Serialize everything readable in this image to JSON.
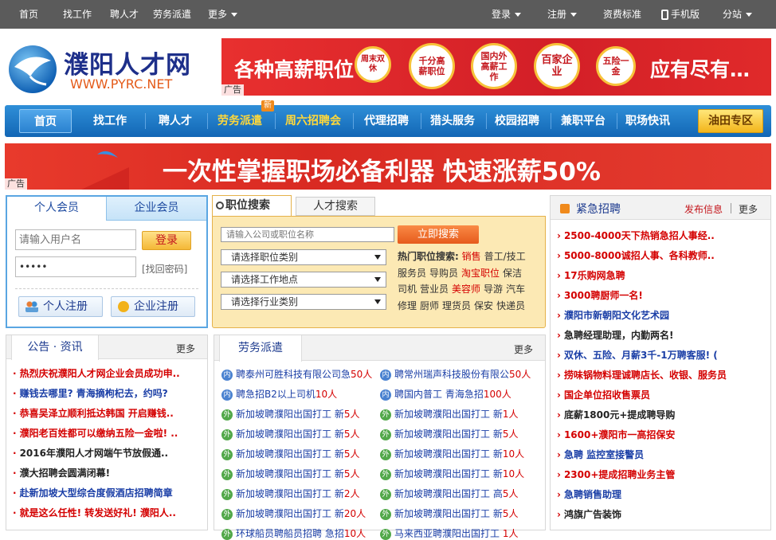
{
  "topbar": {
    "left": [
      "首页",
      "找工作",
      "聘人才",
      "劳务派遣",
      "更多"
    ],
    "login": "登录",
    "register": "注册",
    "fee": "资费标准",
    "mobile": "手机版",
    "branch": "分站"
  },
  "logo": {
    "name": "濮阳人才网",
    "url": "WWW.PYRC.NET"
  },
  "banner_top": {
    "headline": "各种高薪职位",
    "badges": [
      "周末双休",
      "千分高薪职位",
      "国内外高薪工作",
      "百家企业",
      "五险一金"
    ],
    "tail": "应有尽有…",
    "ad": "广告"
  },
  "nav": {
    "items": [
      "首页",
      "找工作",
      "聘人才",
      "劳务派遣",
      "周六招聘会",
      "代理招聘",
      "猎头服务",
      "校园招聘",
      "兼职平台",
      "职场快讯"
    ],
    "new_badge": "新",
    "special": "油田专区"
  },
  "banner_mid": {
    "headline": "一次性掌握职场必备利器 快速涨薪50%",
    "ad": "广告"
  },
  "login_panel": {
    "tab_personal": "个人会员",
    "tab_company": "企业会员",
    "username_placeholder": "请输入用户名",
    "password_value": "•••••",
    "login_button": "登录",
    "forgot": "[找回密码]",
    "personal_register": "个人注册",
    "company_register": "企业注册"
  },
  "search": {
    "tab_jobs": "职位搜索",
    "tab_talent": "人才搜索",
    "placeholder": "请输入公司或职位名称",
    "button": "立即搜索",
    "select_category": "请选择职位类别",
    "select_location": "请选择工作地点",
    "select_industry": "请选择行业类别",
    "hot_label": "热门职位搜索:",
    "hot_lines": [
      [
        {
          "t": "销售",
          "red": true
        },
        {
          "t": "普工/技工",
          "red": false
        }
      ],
      [
        {
          "t": "服务员",
          "red": false
        },
        {
          "t": "导购员",
          "red": false
        },
        {
          "t": "淘宝职位",
          "red": true
        },
        {
          "t": "保洁",
          "red": false
        }
      ],
      [
        {
          "t": "司机",
          "red": false
        },
        {
          "t": "营业员",
          "red": false
        },
        {
          "t": "美容师",
          "red": true
        },
        {
          "t": "导游",
          "red": false
        },
        {
          "t": "汽车",
          "red": false
        }
      ],
      [
        {
          "t": "修理",
          "red": false
        },
        {
          "t": "厨师",
          "red": false
        },
        {
          "t": "理货员",
          "red": false
        },
        {
          "t": "保安",
          "red": false
        },
        {
          "t": "快递员",
          "red": false
        }
      ]
    ]
  },
  "urgent": {
    "title": "紧急招聘",
    "publish": "发布信息",
    "more": "更多",
    "items": [
      {
        "t": "2500-4000天下热销急招人事经..",
        "c": "red"
      },
      {
        "t": "5000-8000诚招人事、各科教师..",
        "c": "red"
      },
      {
        "t": "17乐购网急聘",
        "c": "red"
      },
      {
        "t": "3000聘厨师一名!",
        "c": "red"
      },
      {
        "t": "濮阳市新朝阳文化艺术园",
        "c": "blue"
      },
      {
        "t": "急聘经理助理，内勤两名!",
        "c": "black"
      },
      {
        "t": "双休、五险、月薪3千-1万聘客服! (",
        "c": "blue"
      },
      {
        "t": "捞味锅物料理诚聘店长、收银、服务员",
        "c": "red"
      },
      {
        "t": "国企单位招收售票员",
        "c": "red"
      },
      {
        "t": "底薪1800元+提成聘导购",
        "c": "black"
      },
      {
        "t": "1600+濮阳市一高招保安",
        "c": "red"
      },
      {
        "t": "急聘 监控室接警员",
        "c": "blue"
      },
      {
        "t": "2300+提成招聘业务主管",
        "c": "red"
      },
      {
        "t": "急聘销售助理",
        "c": "blue"
      },
      {
        "t": "鸿旗广告装饰",
        "c": "black"
      }
    ]
  },
  "news": {
    "title": "公告 · 资讯",
    "more": "更多",
    "items": [
      {
        "t": "热烈庆祝濮阳人才网企业会员成功申..",
        "c": "red"
      },
      {
        "t": "赚钱去哪里? 青海摘枸杞去，约吗?",
        "c": "blue"
      },
      {
        "t": "恭喜吴泽立顺利抵达韩国 开启赚钱..",
        "c": "red"
      },
      {
        "t": "濮阳老百姓都可以缴纳五险一金啦! ..",
        "c": "red"
      },
      {
        "t": "2016年濮阳人才网端午节放假通..",
        "c": "black"
      },
      {
        "t": "濮大招聘会圆满闭幕!",
        "c": "black"
      },
      {
        "t": "赴新加坡大型综合度假酒店招聘简章",
        "c": "blue"
      },
      {
        "t": "就是这么任性! 转发送好礼! 濮阳人..",
        "c": "red"
      }
    ]
  },
  "labor": {
    "title": "劳务派遣",
    "more": "更多",
    "left": [
      {
        "icon": "内",
        "color": "b",
        "parts": [
          {
            "t": "聘泰州可胜科技有限公司急",
            "c": "blue"
          },
          {
            "t": "50人",
            "c": "red"
          }
        ]
      },
      {
        "icon": "内",
        "color": "b",
        "parts": [
          {
            "t": "聘急招B2以上司机",
            "c": "blue"
          },
          {
            "t": "10人",
            "c": "red"
          }
        ]
      },
      {
        "icon": "外",
        "color": "g",
        "parts": [
          {
            "t": "新加坡聘濮阳出国打工 新",
            "c": "blue"
          },
          {
            "t": "5人",
            "c": "red"
          }
        ]
      },
      {
        "icon": "外",
        "color": "g",
        "parts": [
          {
            "t": "新加坡聘濮阳出国打工 新",
            "c": "blue"
          },
          {
            "t": "5人",
            "c": "red"
          }
        ]
      },
      {
        "icon": "外",
        "color": "g",
        "parts": [
          {
            "t": "新加坡聘濮阳出国打工 新",
            "c": "blue"
          },
          {
            "t": "5人",
            "c": "red"
          }
        ]
      },
      {
        "icon": "外",
        "color": "g",
        "parts": [
          {
            "t": "新加坡聘濮阳出国打工 新",
            "c": "blue"
          },
          {
            "t": "5人",
            "c": "red"
          }
        ]
      },
      {
        "icon": "外",
        "color": "g",
        "parts": [
          {
            "t": "新加坡聘濮阳出国打工 新",
            "c": "blue"
          },
          {
            "t": "2人",
            "c": "red"
          }
        ]
      },
      {
        "icon": "外",
        "color": "g",
        "parts": [
          {
            "t": "新加坡聘濮阳出国打工 新",
            "c": "blue"
          },
          {
            "t": "20人",
            "c": "red"
          }
        ]
      },
      {
        "icon": "外",
        "color": "g",
        "parts": [
          {
            "t": "环球船员聘船员招聘 急招",
            "c": "blue"
          },
          {
            "t": "10人",
            "c": "red"
          }
        ]
      }
    ],
    "right": [
      {
        "icon": "内",
        "color": "b",
        "parts": [
          {
            "t": "聘常州瑞声科技股份有限公",
            "c": "blue"
          },
          {
            "t": "50人",
            "c": "red"
          }
        ]
      },
      {
        "icon": "内",
        "color": "b",
        "parts": [
          {
            "t": "聘国内普工 青海急招",
            "c": "blue"
          },
          {
            "t": "100人",
            "c": "red"
          }
        ]
      },
      {
        "icon": "外",
        "color": "g",
        "parts": [
          {
            "t": "新加坡聘濮阳出国打工 新",
            "c": "blue"
          },
          {
            "t": "1人",
            "c": "red"
          }
        ]
      },
      {
        "icon": "外",
        "color": "g",
        "parts": [
          {
            "t": "新加坡聘濮阳出国打工 新",
            "c": "blue"
          },
          {
            "t": "5人",
            "c": "red"
          }
        ]
      },
      {
        "icon": "外",
        "color": "g",
        "parts": [
          {
            "t": "新加坡聘濮阳出国打工 新",
            "c": "blue"
          },
          {
            "t": "10人",
            "c": "red"
          }
        ]
      },
      {
        "icon": "外",
        "color": "g",
        "parts": [
          {
            "t": "新加坡聘濮阳出国打工 新",
            "c": "blue"
          },
          {
            "t": "10人",
            "c": "red"
          }
        ]
      },
      {
        "icon": "外",
        "color": "g",
        "parts": [
          {
            "t": "新加坡聘濮阳出国打工 高",
            "c": "blue"
          },
          {
            "t": "5人",
            "c": "red"
          }
        ]
      },
      {
        "icon": "外",
        "color": "g",
        "parts": [
          {
            "t": "新加坡聘濮阳出国打工 新",
            "c": "blue"
          },
          {
            "t": "5人",
            "c": "red"
          }
        ]
      },
      {
        "icon": "外",
        "color": "g",
        "parts": [
          {
            "t": "马来西亚聘濮阳出国打工 ",
            "c": "blue"
          },
          {
            "t": "1人",
            "c": "red"
          }
        ]
      }
    ]
  }
}
